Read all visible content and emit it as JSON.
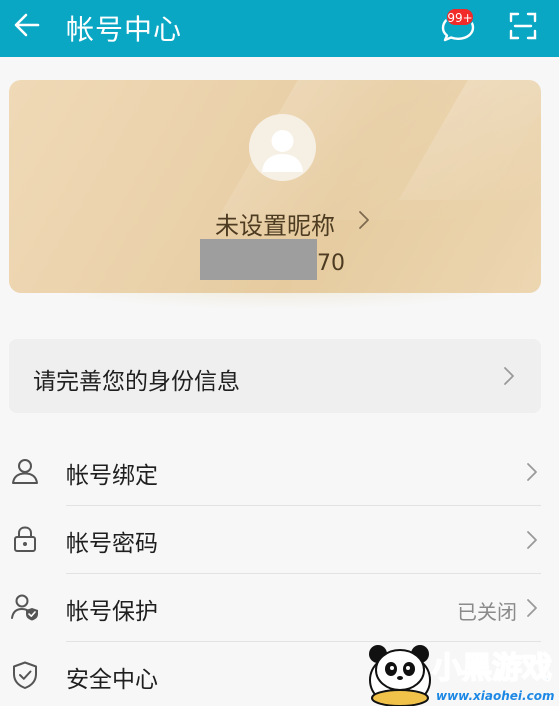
{
  "header": {
    "title": "帐号中心",
    "message_badge": "99+",
    "background_color": "#0aa7c4",
    "icons": [
      "back-arrow-icon",
      "message-icon",
      "scan-icon"
    ]
  },
  "profile": {
    "nickname": "未设置昵称",
    "account_suffix": "70",
    "avatar_icon": "default-avatar-icon"
  },
  "identity_banner": {
    "label": "请完善您的身份信息"
  },
  "menu": [
    {
      "label": "帐号绑定",
      "icon": "user-icon",
      "value": ""
    },
    {
      "label": "帐号密码",
      "icon": "lock-icon",
      "value": ""
    },
    {
      "label": "帐号保护",
      "icon": "user-shield-icon",
      "value": "已关闭"
    },
    {
      "label": "安全中心",
      "icon": "shield-check-icon",
      "value": ""
    }
  ],
  "watermark": {
    "title": "小黑游戏",
    "url": "www.xiaohei.com"
  }
}
